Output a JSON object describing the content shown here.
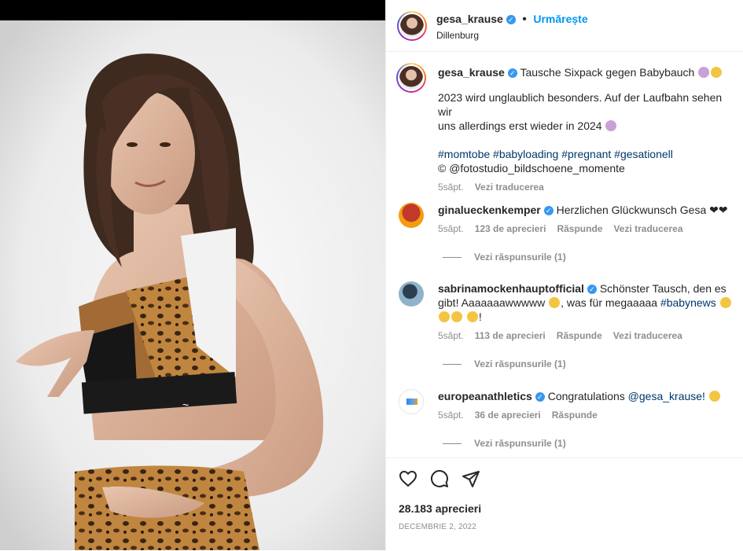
{
  "post": {
    "username": "gesa_krause",
    "verified_mark": "✓",
    "follow_label": "Urmărește",
    "location": "Dillenburg",
    "caption_title": "Tausche Sixpack gegen Babybauch",
    "caption_line1": "2023 wird unglaublich besonders. Auf der Laufbahn sehen wir",
    "caption_line2": "uns allerdings erst wieder in 2024",
    "hashtags": "#momtobe #babyloading #pregnant #gesationell",
    "credit": "© @fotostudio_bildschoene_momente",
    "caption_time": "5săpt.",
    "translate_label": "Vezi traducerea"
  },
  "comments": [
    {
      "username": "ginalueckenkemper",
      "text": "Herzlichen Glückwunsch Gesa ❤❤",
      "time": "5săpt.",
      "likes": "123 de aprecieri",
      "reply": "Răspunde",
      "translate": "Vezi traducerea",
      "view_replies": "Vezi răspunsurile (1)"
    },
    {
      "username": "sabrinamockenhauptofficial",
      "text_a": "Schönster Tausch, den es gibt!",
      "text_b": "Aaaaaaawwwww",
      "text_c": ", was für megaaaaa",
      "hashtag": "#babynews",
      "text_d": "!",
      "time": "5săpt.",
      "likes": "113 de aprecieri",
      "reply": "Răspunde",
      "translate": "Vezi traducerea",
      "view_replies": "Vezi răspunsurile (1)"
    },
    {
      "username": "europeanathletics",
      "text_a": "Congratulations",
      "mention": "@gesa_krause!",
      "time": "5săpt.",
      "likes": "36 de aprecieri",
      "reply": "Răspunde",
      "view_replies": "Vezi răspunsurile (1)"
    }
  ],
  "footer": {
    "likes": "28.183 aprecieri",
    "date": "DECEMBRIE 2, 2022"
  },
  "icons": {
    "like": "heart-icon",
    "comment": "comment-icon",
    "share": "share-icon"
  },
  "colors": {
    "link_blue": "#0095f6",
    "verified_blue": "#3897f0",
    "hashtag": "#00376b",
    "muted": "#8e8e8e"
  }
}
